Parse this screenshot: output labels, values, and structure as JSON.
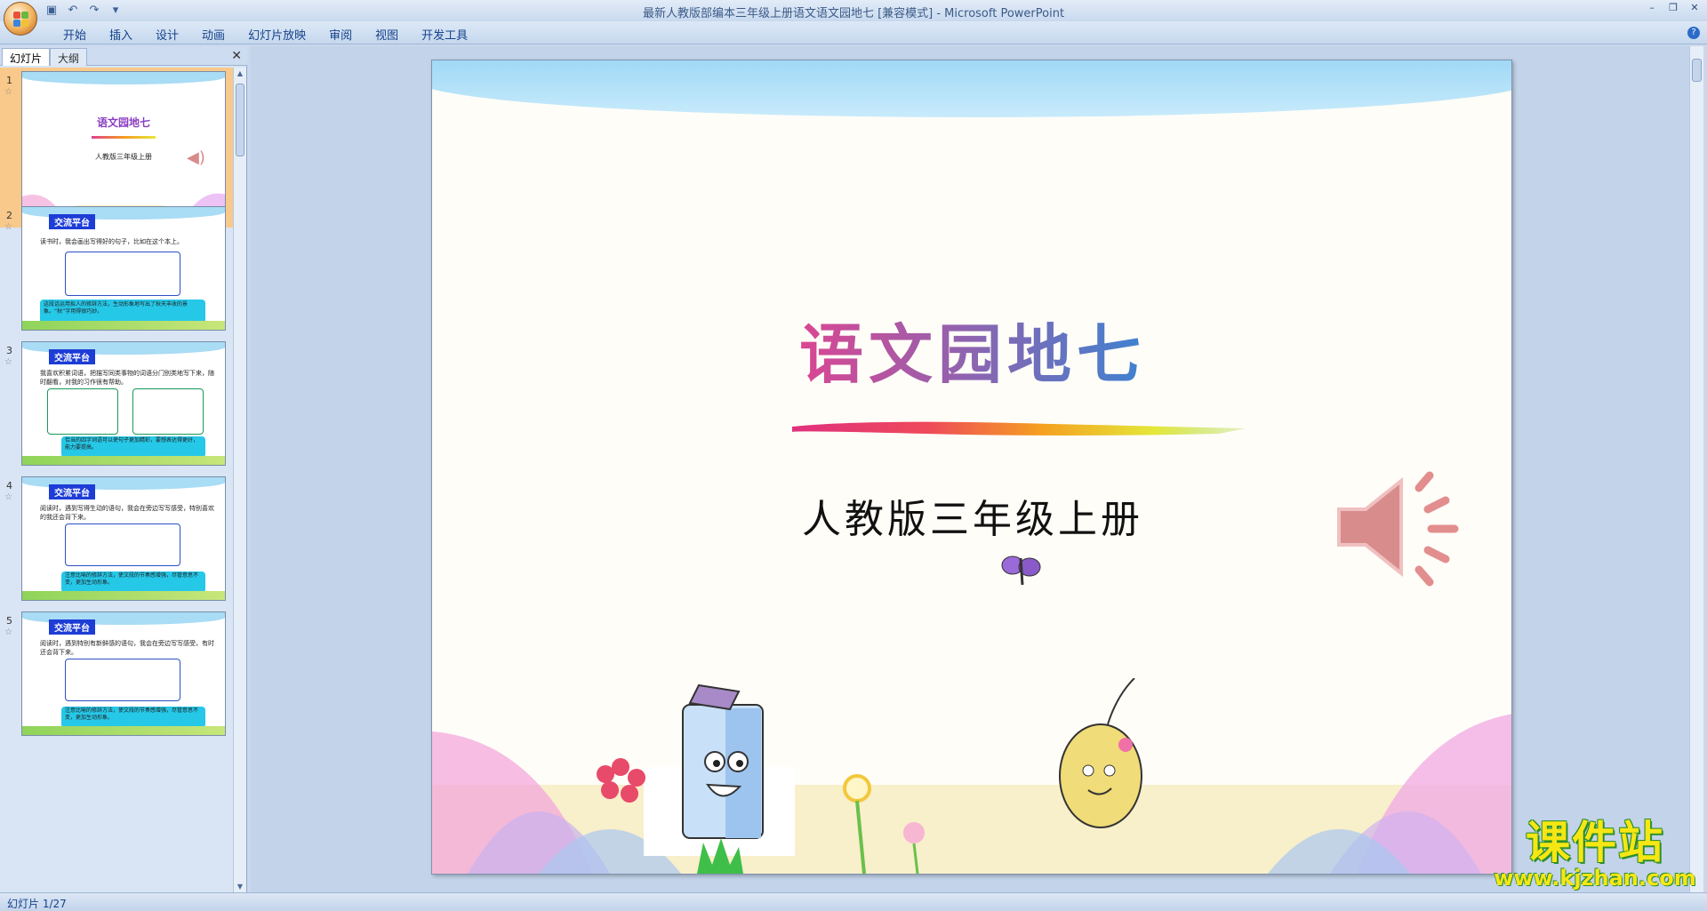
{
  "window": {
    "title": "最新人教版部编本三年级上册语文语文园地七 [兼容模式] - Microsoft PowerPoint"
  },
  "menu": [
    "开始",
    "插入",
    "设计",
    "动画",
    "幻灯片放映",
    "审阅",
    "视图",
    "开发工具"
  ],
  "left_pane": {
    "tabs": [
      "幻灯片",
      "大纲"
    ],
    "thumbnails": [
      {
        "num": "1",
        "title": "语文园地七",
        "subtitle": "人教版三年级上册"
      },
      {
        "num": "2",
        "header": "交流平台",
        "text": "读书时，我会画出写得好的句子，比如在这个本上。",
        "note": "这段话运用拟人的修辞方法，生动形象地写出了秋天丰收的景象。“秋”字用得很巧妙。"
      },
      {
        "num": "3",
        "header": "交流平台",
        "text": "我喜欢积累词语，把描写同类事物的词语分门别类地写下来，随时翻看，对我的习作很有帮助。",
        "note": "恰当的四字词语可以使句子更加精彩，要想表达得更好，能力要提高。"
      },
      {
        "num": "4",
        "header": "交流平台",
        "text": "阅读时，遇到写得生动的语句，我会在旁边写写感受，特别喜欢的我还会背下来。",
        "note": "注意比喻的修辞方法，使文段的节奏感增强，尽管意思不变，更加生动形象。"
      },
      {
        "num": "5",
        "header": "交流平台",
        "text": "阅读时，遇到特别有新鲜感的语句，我会在旁边写写感受，有时还会背下来。",
        "note": "注意比喻的修辞方法，使文段的节奏感增强，尽管意思不变，更加生动形象。"
      }
    ]
  },
  "slide": {
    "title": "语文园地七",
    "subtitle": "人教版三年级上册"
  },
  "status": {
    "slide_counter": "幻灯片 1/27"
  },
  "watermark": {
    "main": "课件站",
    "url": "www.kjzhan.com"
  },
  "icons": [
    "office-button-icon",
    "save-icon",
    "undo-icon",
    "redo-icon",
    "speaker-icon",
    "help-icon",
    "close-icon"
  ]
}
